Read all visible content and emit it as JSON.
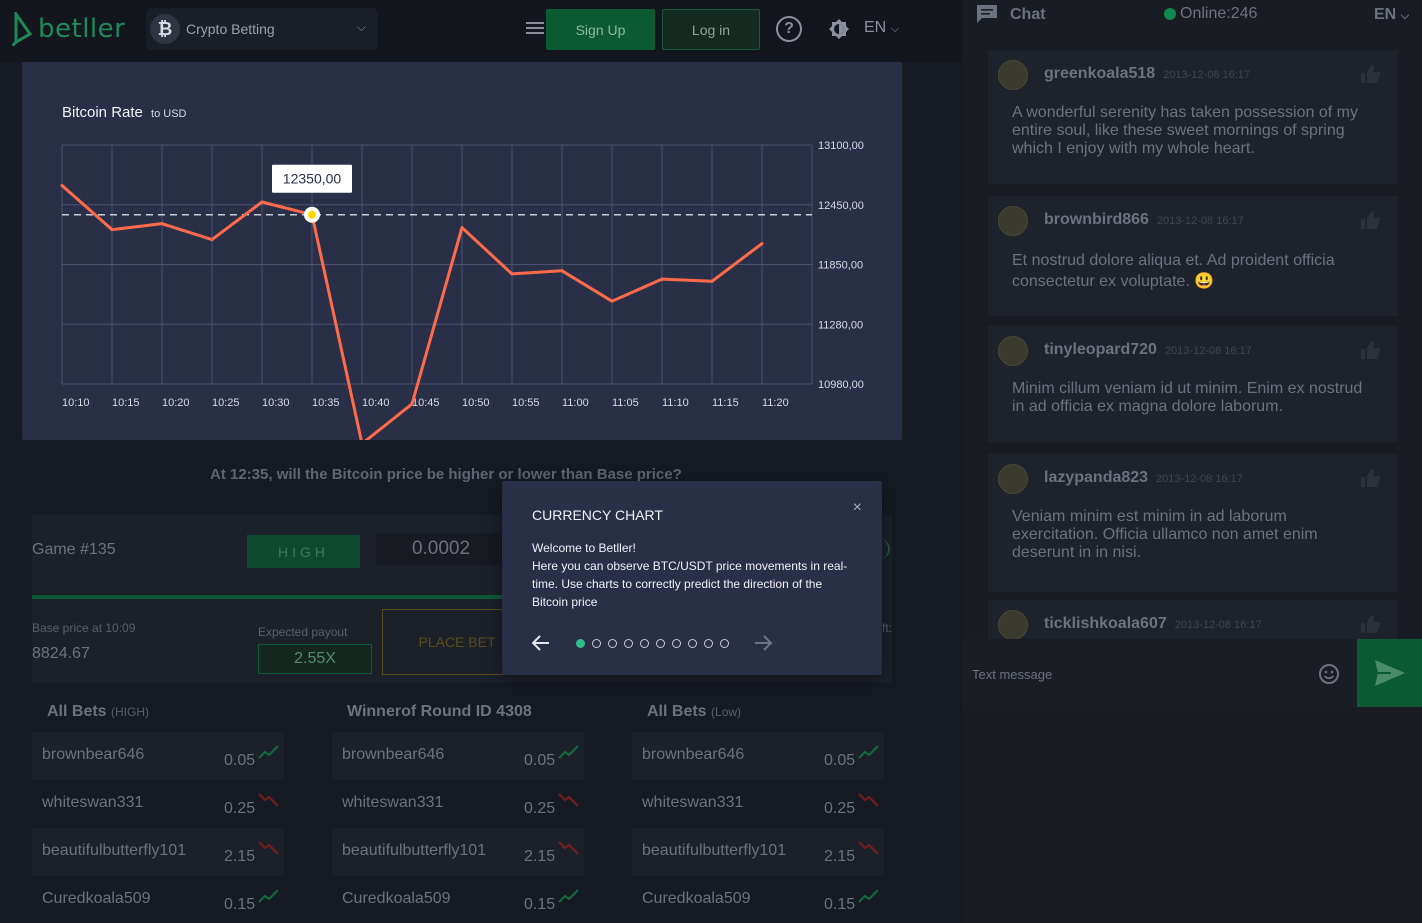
{
  "header": {
    "logo_text": "betller",
    "category_label": "Crypto Betting",
    "signup_label": "Sign Up",
    "login_label": "Log in",
    "help_label": "?",
    "language": "EN"
  },
  "chart": {
    "title": "Bitcoin Rate",
    "unit": "to USD",
    "tooltip_value": "12350,00"
  },
  "chart_data": {
    "type": "line",
    "title": "Bitcoin Rate",
    "subtitle": "to USD",
    "x_tick_labels": [
      "10:10",
      "10:15",
      "10:20",
      "10:25",
      "10:30",
      "10:35",
      "10:40",
      "10:45",
      "10:50",
      "10:55",
      "11:00",
      "11:05",
      "11:10",
      "11:15",
      "11:20"
    ],
    "y_tick_labels": [
      "13100,00",
      "12450,00",
      "11850,00",
      "11280,00",
      "10980,00"
    ],
    "y_ticks": [
      13100,
      12450,
      11850,
      11280,
      10980
    ],
    "series": [
      {
        "values": [
          12660,
          12200,
          12260,
          12100,
          12480,
          12350,
          10680,
          10880,
          12220,
          11760,
          11790,
          11500,
          11710,
          11690,
          12060
        ]
      }
    ],
    "base_line": 12350,
    "highlight": {
      "x": "10:35",
      "y": 12350
    },
    "colors": {
      "line": "#ff6b4a",
      "grid": "#4b5170",
      "background": "#2a2f48",
      "highlight": "#ffd600"
    },
    "grid": true
  },
  "game": {
    "question": "At 12:35, will the Bitcoin price be higher or lower than Base price?",
    "label": "Game #135",
    "high_label": "HIGH",
    "amount": "0.0002",
    "base_label": "Base price at 10:09",
    "base_value": "8824.67",
    "payout_label": "Expected payout",
    "payout_value": "2.55X",
    "place_bet_label": "PLACE BET",
    "side_letter": "ft:",
    "progress": 0.55
  },
  "bets": [
    {
      "title": "All Bets",
      "subtitle": "(HIGH)",
      "rows": [
        {
          "name": "brownbear646",
          "amount": "0.05",
          "trend": "up"
        },
        {
          "name": "whiteswan331",
          "amount": "0.25",
          "trend": "down"
        },
        {
          "name": "beautifulbutterfly101",
          "amount": "2.15",
          "trend": "down"
        },
        {
          "name": "Curedkoala509",
          "amount": "0.15",
          "trend": "up"
        }
      ]
    },
    {
      "title": "Winnerof Round ID 4308",
      "subtitle": "",
      "rows": [
        {
          "name": "brownbear646",
          "amount": "0.05",
          "trend": "up"
        },
        {
          "name": "whiteswan331",
          "amount": "0.25",
          "trend": "down"
        },
        {
          "name": "beautifulbutterfly101",
          "amount": "2.15",
          "trend": "down"
        },
        {
          "name": "Curedkoala509",
          "amount": "0.15",
          "trend": "up"
        }
      ]
    },
    {
      "title": "All Bets",
      "subtitle": "(Low)",
      "rows": [
        {
          "name": "brownbear646",
          "amount": "0.05",
          "trend": "up"
        },
        {
          "name": "whiteswan331",
          "amount": "0.25",
          "trend": "down"
        },
        {
          "name": "beautifulbutterfly101",
          "amount": "2.15",
          "trend": "down"
        },
        {
          "name": "Curedkoala509",
          "amount": "0.15",
          "trend": "up"
        }
      ]
    }
  ],
  "modal": {
    "title": "CURRENCY CHART",
    "close": "×",
    "line1": "Welcome to Betller!",
    "line2": "Here you can observe BTC/USDT price movements in real-time. Use charts to correctly predict the direction of the Bitcoin price",
    "dots_total": 10,
    "dots_active": 0
  },
  "chat": {
    "title": "Chat",
    "online": "Online:246",
    "language": "EN",
    "input_placeholder": "Text message",
    "messages": [
      {
        "user": "greenkoala518",
        "time": "2013-12-08 16:17",
        "text": "A wonderful serenity has taken possession of my entire soul, like these sweet mornings of spring which I enjoy with my whole heart."
      },
      {
        "user": "brownbird866",
        "time": "2013-12-08 16:17",
        "text": "Et nostrud dolore aliqua et. Ad proident officia consectetur ex voluptate. 😃"
      },
      {
        "user": "tinyleopard720",
        "time": "2013-12-08 16:17",
        "text": "Minim cillum veniam id ut minim. Enim ex nostrud in ad officia ex magna dolore laborum."
      },
      {
        "user": "lazypanda823",
        "time": "2013-12-08 16:17",
        "text": "Veniam minim est minim in ad laborum exercitation. Officia ullamco non amet enim deserunt in in nisi."
      },
      {
        "user": "ticklishkoala607",
        "time": "2013-12-08 16:17",
        "text": ""
      }
    ]
  }
}
